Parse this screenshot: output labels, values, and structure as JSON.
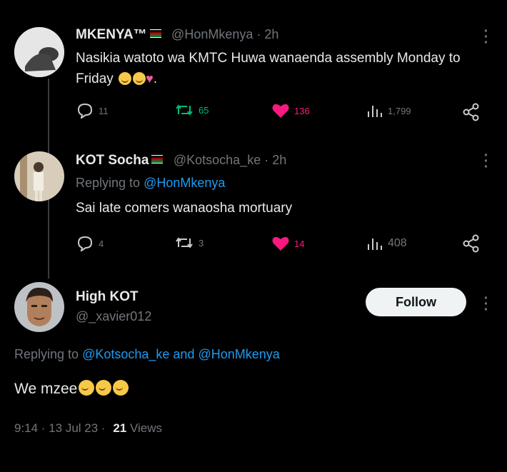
{
  "tweets": [
    {
      "name": "MKENYA™",
      "handle": "@HonMkenya · 2h",
      "text": "Nasikia watoto wa KMTC Huwa wanaenda assembly Monday to Friday",
      "replies": "11",
      "retweets": "65",
      "likes": "136",
      "views": "1,799"
    },
    {
      "name": "KOT Socha",
      "handle": "@Kotsocha_ke · 2h",
      "replying_prefix": "Replying to",
      "replying_to": "@HonMkenya",
      "text": "Sai late comers wanaosha mortuary",
      "replies": "4",
      "retweets": "3",
      "likes": "14",
      "views": "408"
    }
  ],
  "main": {
    "name": "High KOT",
    "handle": "@_xavier012",
    "follow_label": "Follow",
    "replying_prefix": "Replying to",
    "replying_to": "@Kotsocha_ke and @HonMkenya",
    "text": "We mzee",
    "timestamp": "9:14 · 13 Jul 23 ·",
    "views_count": "21",
    "views_label": "Views"
  },
  "colors": {
    "background": "#000000",
    "link": "#1d9bf0",
    "retweet": "#00ba7c",
    "like": "#f91880",
    "muted": "#71767b"
  },
  "icons": [
    "reply-icon",
    "retweet-icon",
    "heart-icon",
    "views-icon",
    "share-icon",
    "more-icon"
  ]
}
